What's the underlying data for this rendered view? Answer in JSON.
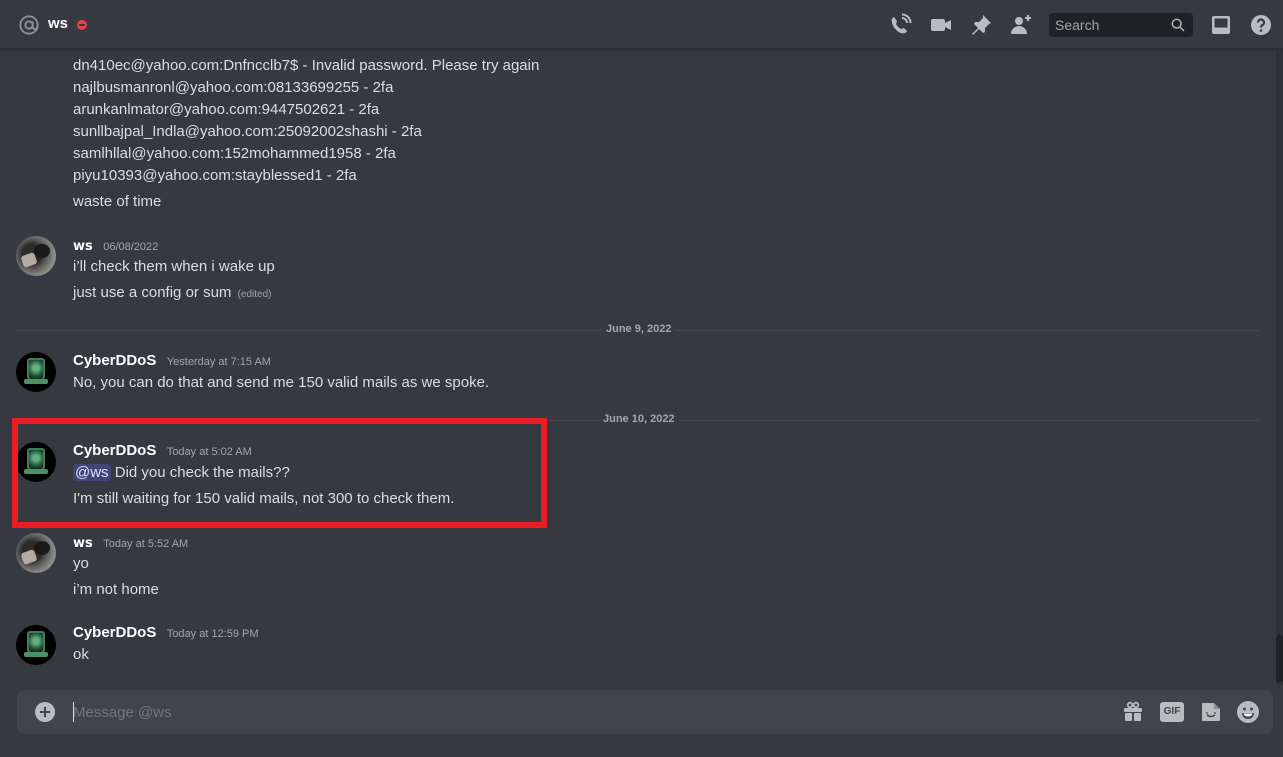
{
  "header": {
    "channel_title": "ws",
    "status": "do-not-disturb",
    "icons": [
      "at-sign-icon",
      "voice-call-icon",
      "video-call-icon",
      "pinned-messages-icon",
      "add-friend-icon",
      "inbox-icon",
      "help-icon"
    ],
    "search_placeholder": "Search"
  },
  "messages": {
    "continued_lines": [
      "dn410ec@yahoo.com:Dnfncclb7$ - Invalid password. Please try again",
      "najlbusmanronl@yahoo.com:08133699255 - 2fa",
      "arunkanlmator@yahoo.com:9447502621 - 2fa",
      "sunllbajpal_Indla@yahoo.com:25092002shashi - 2fa",
      "samlhllal@yahoo.com:152mohammed1958 - 2fa",
      "piyu10393@yahoo.com:stayblessed1 - 2fa",
      "waste of time"
    ],
    "groups": [
      {
        "author": "ws",
        "timestamp": "06/08/2022",
        "lines": [
          "i’ll check them when i wake up",
          "just use a config or sum"
        ],
        "edited_label": "(edited)"
      },
      {
        "author": "CyberDDoS",
        "timestamp": "Yesterday at 7:15 AM",
        "lines": [
          "No, you can do that and send me 150 valid mails as we spoke."
        ]
      },
      {
        "author": "CyberDDoS",
        "timestamp": "Today at 5:02 AM",
        "mention": "@ws",
        "lines": [
          "Did you check the mails??",
          "I'm still waiting for 150 valid mails, not 300 to check them."
        ],
        "highlighted": true
      },
      {
        "author": "ws",
        "timestamp": "Today at 5:52 AM",
        "lines": [
          "yo",
          "i’m not home"
        ]
      },
      {
        "author": "CyberDDoS",
        "timestamp": "Today at 12:59 PM",
        "lines": [
          "ok"
        ]
      }
    ],
    "date_dividers": [
      "June 9, 2022",
      "June 10, 2022"
    ]
  },
  "composer": {
    "placeholder": "Message @ws",
    "gif_label": "GIF",
    "icons": [
      "add-attachment-icon",
      "gift-icon",
      "gif-icon",
      "sticker-icon",
      "emoji-icon"
    ]
  },
  "colors": {
    "background": "#36393f",
    "header_text": "#ffffff",
    "dnd_status": "#ed4245",
    "highlight_box": "#ec1c24",
    "mention_bg": "#5865f2"
  }
}
